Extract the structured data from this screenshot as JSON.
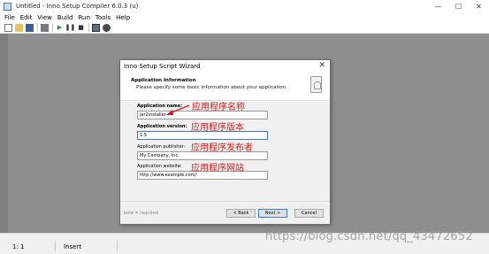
{
  "window": {
    "title": "Untitled - Inno Setup Compiler 6.0.3 (u)"
  },
  "menu": [
    "File",
    "Edit",
    "View",
    "Build",
    "Run",
    "Tools",
    "Help"
  ],
  "status": {
    "position": "1:   1",
    "mode": "Insert"
  },
  "watermark": "https://blog.csdn.net/qq_43472652",
  "dialog": {
    "title": "Inno Setup Script Wizard",
    "header_title": "Application Information",
    "header_subtitle": "Please specify some basic information about your application.",
    "fields": [
      {
        "label": "Application name:",
        "value": "jar2installer",
        "required": true
      },
      {
        "label": "Application version:",
        "value": "1.5",
        "required": true
      },
      {
        "label": "Application publisher:",
        "value": "My Company, Inc.",
        "required": false
      },
      {
        "label": "Application website:",
        "value": "http://www.example.com/",
        "required": false
      }
    ],
    "footer_note": "bold = required",
    "buttons": {
      "back": "< Back",
      "next": "Next >",
      "cancel": "Cancel"
    }
  },
  "annotations": [
    "应用程序名称",
    "应用程序版本",
    "应用程序发布者",
    "应用程序网站"
  ],
  "colors": {
    "annotation": "#e01818",
    "focus": "#3a7bd5",
    "editor_bg": "#8f8f8f"
  }
}
